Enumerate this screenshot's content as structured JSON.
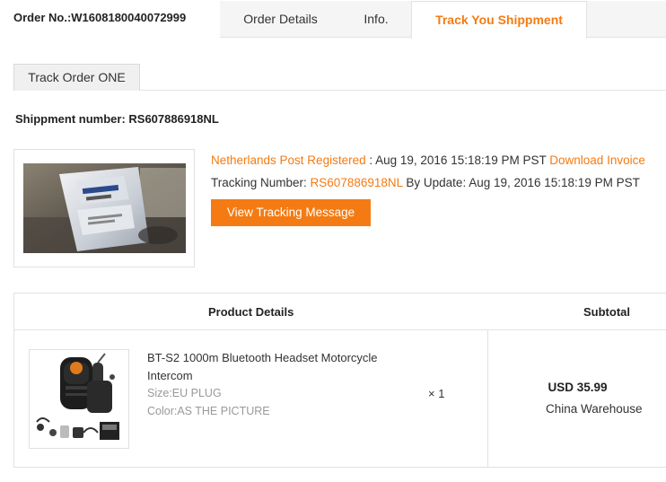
{
  "header": {
    "order_no": "Order No.:W1608180040072999",
    "tabs": [
      {
        "label": "Order Details"
      },
      {
        "label": "Info."
      },
      {
        "label": "Track You Shippment"
      }
    ]
  },
  "subtab": {
    "label": "Track Order ONE"
  },
  "shipment": {
    "number_label": "Shippment number: RS607886918NL",
    "carrier": "Netherlands Post Registered",
    "date_text": ": Aug 19, 2016 15:18:19 PM PST",
    "download_invoice": "Download Invoice",
    "tracking_label": "Tracking Number:",
    "tracking_number": "RS607886918NL",
    "by_update": "By Update: Aug 19, 2016 15:18:19 PM PST",
    "view_button": "View Tracking Message"
  },
  "product_table": {
    "header_product": "Product Details",
    "header_subtotal": "Subtotal",
    "item": {
      "name": "BT-S2 1000m Bluetooth Headset Motorcycle Intercom",
      "size": "Size:EU PLUG",
      "color": "Color:AS THE PICTURE",
      "qty": "× 1",
      "price": "USD 35.99",
      "warehouse": "China Warehouse"
    }
  },
  "colors": {
    "accent": "#f47b13",
    "border": "#e2e2e2",
    "tab_bg": "#f5f5f5"
  }
}
